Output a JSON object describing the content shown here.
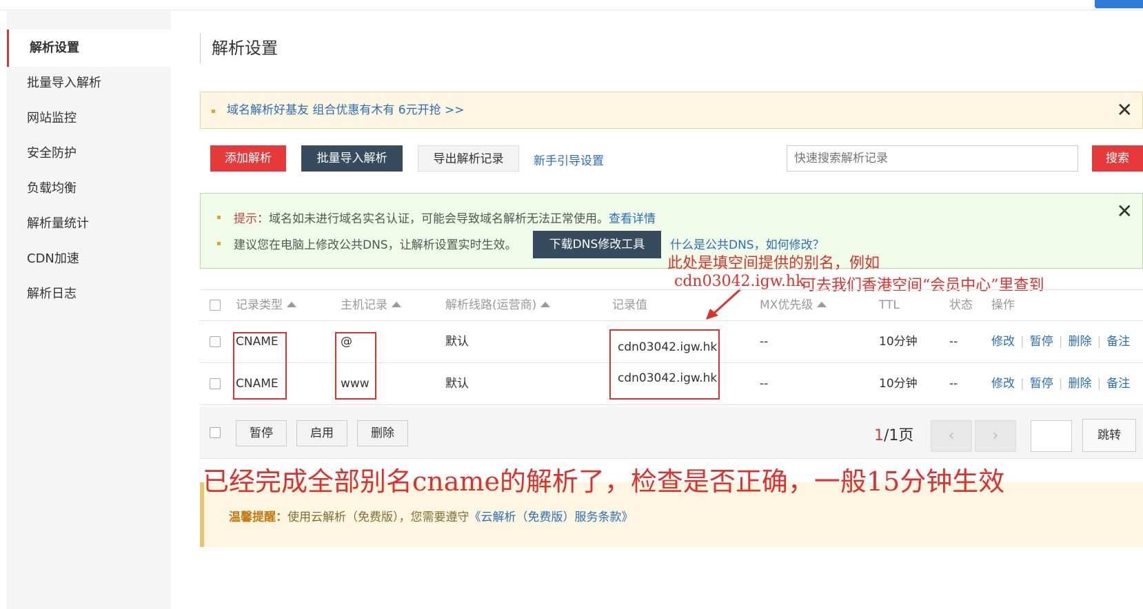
{
  "sidebar": {
    "items": [
      {
        "label": "解析设置",
        "active": true
      },
      {
        "label": "批量导入解析"
      },
      {
        "label": "网站监控"
      },
      {
        "label": "安全防护"
      },
      {
        "label": "负载均衡"
      },
      {
        "label": "解析量统计"
      },
      {
        "label": "CDN加速"
      },
      {
        "label": "解析日志"
      }
    ]
  },
  "page": {
    "title": "解析设置"
  },
  "promo": {
    "text": "域名解析好基友 组合优惠有木有 6元开抢 >>"
  },
  "toolbar": {
    "add": "添加解析",
    "batch_import": "批量导入解析",
    "export": "导出解析记录",
    "guide": "新手引导设置",
    "search_placeholder": "快速搜索解析记录",
    "search": "搜索"
  },
  "notice": {
    "hint_label": "提示",
    "hint_text": "：域名如未进行域名实名认证，可能会导致域名解析无法正常使用。",
    "hint_link": "查看详情",
    "dns_text": "建议您在电脑上修改公共DNS，让解析设置实时生效。",
    "dns_button": "下载DNS修改工具",
    "dns_link": "什么是公共DNS，如何修改？"
  },
  "annotations": {
    "line1": "此处是填空间提供的别名，例如",
    "line2": "cdn03042.igw.hk",
    "line3": "可去我们香港空间“会员中心”里查到",
    "big": "已经完成全部别名cname的解析了，检查是否正确，一般15分钟生效"
  },
  "table": {
    "headers": {
      "type": "记录类型",
      "host": "主机记录",
      "line": "解析线路(运营商)",
      "value": "记录值",
      "mx": "MX优先级",
      "ttl": "TTL",
      "status": "状态",
      "ops": "操作"
    },
    "rows": [
      {
        "type": "CNAME",
        "host": "@",
        "line": "默认",
        "value": "cdn03042.igw.hk",
        "mx": "--",
        "ttl": "10分钟",
        "status": "--"
      },
      {
        "type": "CNAME",
        "host": "www",
        "line": "默认",
        "value": "cdn03042.igw.hk",
        "mx": "--",
        "ttl": "10分钟",
        "status": "--"
      }
    ],
    "ops": {
      "edit": "修改",
      "pause": "暂停",
      "delete": "删除",
      "note": "备注"
    }
  },
  "footer": {
    "pause": "暂停",
    "enable": "启用",
    "delete": "删除",
    "page_current": "1",
    "page_total": "/1页",
    "jump": "跳转"
  },
  "warm": {
    "label": "温馨提醒：",
    "text": "使用云解析（免费版），您需要遵守",
    "link": "《云解析（免费版）服务条款》"
  }
}
